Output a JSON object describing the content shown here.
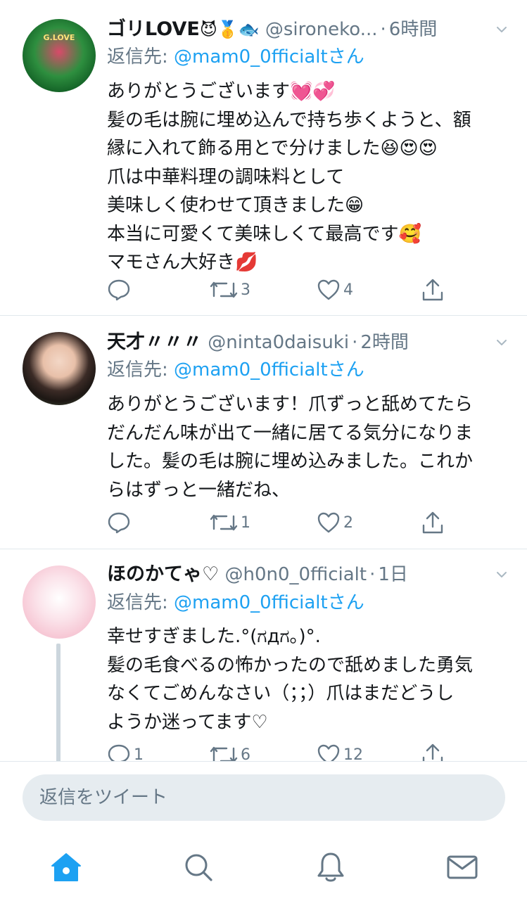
{
  "tweets": [
    {
      "name": "ゴリLOVE",
      "name_emoji": "😈🥇🐟",
      "handle": "@sironeko...",
      "time": "6時間",
      "reply_prefix": "返信先: ",
      "reply_to": "@mam0_0fficialtさん",
      "avatar_text": "G.LOVE",
      "body": [
        "ありがとうございます💓💞",
        "髪の毛は腕に埋め込んで持ち歩くようと、額",
        "縁に入れて飾る用とで分けました😆😍😍",
        "爪は中華料理の調味料として",
        "美味しく使わせて頂きました😁",
        "本当に可愛くて美味しくて最高です🥰",
        "マモさん大好き💋"
      ],
      "replies": "",
      "retweets": "3",
      "likes": "4"
    },
    {
      "name": "天才〃〃〃",
      "name_emoji": "",
      "handle": "@ninta0daisuki",
      "time": "2時間",
      "reply_prefix": "返信先: ",
      "reply_to": "@mam0_0fficialtさん",
      "avatar_text": "",
      "body": [
        "ありがとうございます！爪ずっと舐めてたら",
        "だんだん味が出て一緒に居てる気分になりま",
        "した。髪の毛は腕に埋め込みました。これか",
        "らはずっと一緒だね、"
      ],
      "replies": "",
      "retweets": "1",
      "likes": "2"
    },
    {
      "name": "ほのかてゃ♡",
      "name_emoji": "",
      "handle": "@h0n0_0fficialt",
      "time": "1日",
      "reply_prefix": "返信先: ",
      "reply_to": "@mam0_0fficialtさん",
      "avatar_text": "",
      "body": [
        "幸せすぎました.°(ಗдಗ。)°.",
        "髪の毛食べるの怖かったので舐めました勇気",
        "なくてごめんなさい（；；）爪はまだどうし",
        "ようか迷ってます♡"
      ],
      "replies": "1",
      "retweets": "6",
      "likes": "12"
    }
  ],
  "reply_bar": {
    "placeholder": "返信をツイート"
  },
  "tabs": [
    {
      "icon": "home-icon",
      "active": true
    },
    {
      "icon": "search-icon",
      "active": false
    },
    {
      "icon": "notifications-bell-icon",
      "active": false
    },
    {
      "icon": "messages-envelope-icon",
      "active": false
    }
  ],
  "colors": {
    "accent": "#1da1f2",
    "muted": "#657786",
    "divider": "#e1e8ed",
    "input_bg": "#e6ecf0",
    "text": "#14171a"
  }
}
